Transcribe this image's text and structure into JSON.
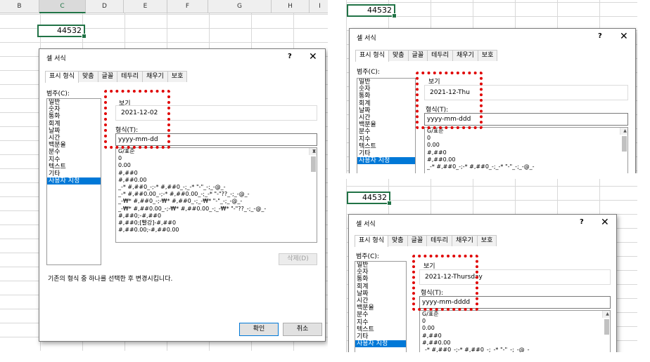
{
  "panels": [
    {
      "columns": [
        "B",
        "C",
        "D",
        "E",
        "F",
        "G",
        "H",
        "I"
      ],
      "cell_value": "44532",
      "dialog": {
        "title": "셀 서식",
        "help": "?",
        "close": "✕",
        "tabs": [
          "표시 형식",
          "맞춤",
          "글꼴",
          "테두리",
          "채우기",
          "보호"
        ],
        "category_label": "범주(C):",
        "categories": [
          "일반",
          "숫자",
          "통화",
          "회계",
          "날짜",
          "시간",
          "백분율",
          "분수",
          "지수",
          "텍스트",
          "기타",
          "사용자 지정"
        ],
        "sample_label": "보기",
        "sample_value": "2021-12-02",
        "format_label": "형식(T):",
        "format_value": "yyyy-mm-dd",
        "format_list": [
          "G/표준",
          "0",
          "0.00",
          "#,##0",
          "#,##0.00",
          "_-* #,##0_-;-* #,##0_-;_-* \"-\"_-;_-@_-",
          "_-* #,##0.00_-;-* #,##0.00_-;_-* \"-\"??_-;_-@_-",
          "_-₩* #,##0_-;-₩* #,##0_-;_-₩* \"-\"_-;_-@_-",
          "_-₩* #,##0.00_-;-₩* #,##0.00_-;_-₩* \"-\"??_-;_-@_-",
          "#,##0;-#,##0",
          "#,##0;[빨강]-#,##0",
          "#,##0.00;-#,##0.00"
        ],
        "delete_button": "삭제(D)",
        "note": "기존의 형식 중 하나를 선택한 후 변경시킵니다.",
        "ok_button": "확인",
        "cancel_button": "취소"
      }
    },
    {
      "cell_value": "44532",
      "dialog": {
        "title": "셀 서식",
        "help": "?",
        "close": "✕",
        "tabs": [
          "표시 형식",
          "맞춤",
          "글꼴",
          "테두리",
          "채우기",
          "보호"
        ],
        "category_label": "범주(C):",
        "categories": [
          "일반",
          "숫자",
          "통화",
          "회계",
          "날짜",
          "시간",
          "백분율",
          "분수",
          "지수",
          "텍스트",
          "기타",
          "사용자 지정"
        ],
        "sample_label": "보기",
        "sample_value": "2021-12-Thu",
        "format_label": "형식(T):",
        "format_value": "yyyy-mm-ddd",
        "format_list": [
          "G/표준",
          "0",
          "0.00",
          "#,##0",
          "#,##0.00",
          "_-* #,##0_-;-* #,##0_-;_-* \"-\"_-;_-@_-"
        ]
      }
    },
    {
      "cell_value": "44532",
      "dialog": {
        "title": "셀 서식",
        "help": "?",
        "close": "✕",
        "tabs": [
          "표시 형식",
          "맞춤",
          "글꼴",
          "테두리",
          "채우기",
          "보호"
        ],
        "category_label": "범주(C):",
        "categories": [
          "일반",
          "숫자",
          "통화",
          "회계",
          "날짜",
          "시간",
          "백분율",
          "분수",
          "지수",
          "텍스트",
          "기타",
          "사용자 지정"
        ],
        "sample_label": "보기",
        "sample_value": "2021-12-Thursday",
        "format_label": "형식(T):",
        "format_value": "yyyy-mm-dddd",
        "format_list": [
          "G/표준",
          "0",
          "0.00",
          "#,##0",
          "#,##0.00",
          "_-* #,##0_-;-* #,##0_-;_-* \"-\"_-;_-@_-"
        ]
      }
    }
  ],
  "colors": {
    "selection": "#0078d7",
    "highlight": "#e00000",
    "excel_green": "#217346"
  }
}
